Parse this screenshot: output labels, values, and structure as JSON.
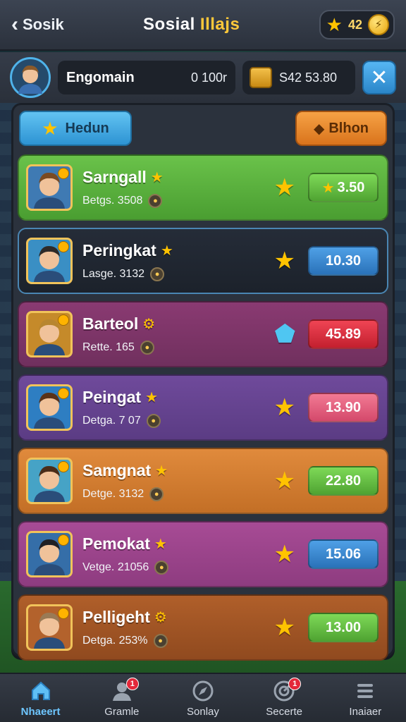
{
  "header": {
    "back_label": "Sosik",
    "title_part1": "Sosial",
    "title_part2": "Illajs",
    "coins": "42"
  },
  "profile": {
    "name": "Engomain",
    "points": "0 100r",
    "chest_value": "S42 53.80"
  },
  "filters": {
    "left_label": "Hedun",
    "right_label": "Blhon"
  },
  "rows": [
    {
      "name": "Sarngall",
      "sub": "Betgs. 3508",
      "value": "3.50",
      "theme": "green",
      "btn": "green",
      "btn_star": true,
      "tag": "★"
    },
    {
      "name": "Peringkat",
      "sub": "Lasge. 3132",
      "value": "10.30",
      "theme": "dark",
      "btn": "blue",
      "btn_star": false,
      "tag": "★"
    },
    {
      "name": "Barteol",
      "sub": "Rette. 165",
      "value": "45.89",
      "theme": "magenta",
      "btn": "red",
      "btn_star": false,
      "tag": "⚙",
      "gem": true
    },
    {
      "name": "Peingat",
      "sub": "Detga. 7 07",
      "value": "13.90",
      "theme": "purple",
      "btn": "pink",
      "btn_star": false,
      "tag": "★"
    },
    {
      "name": "Samgnat",
      "sub": "Detge. 3132",
      "value": "22.80",
      "theme": "orange",
      "btn": "green",
      "btn_star": false,
      "tag": "★"
    },
    {
      "name": "Pemokat",
      "sub": "Vetge. 21056",
      "value": "15.06",
      "theme": "pink",
      "btn": "blue",
      "btn_star": false,
      "tag": "★"
    },
    {
      "name": "Pelligeht",
      "sub": "Detga. 253%",
      "value": "13.00",
      "theme": "brown",
      "btn": "green",
      "btn_star": false,
      "tag": "⚙"
    }
  ],
  "nav": [
    {
      "label": "Nhaeert",
      "icon": "home-icon",
      "active": true,
      "notif": ""
    },
    {
      "label": "Gramle",
      "icon": "user-icon",
      "active": false,
      "notif": "1"
    },
    {
      "label": "Sonlay",
      "icon": "compass-icon",
      "active": false,
      "notif": ""
    },
    {
      "label": "Secerte",
      "icon": "target-icon",
      "active": false,
      "notif": "1"
    },
    {
      "label": "Inaiaer",
      "icon": "menu-icon",
      "active": false,
      "notif": ""
    }
  ]
}
